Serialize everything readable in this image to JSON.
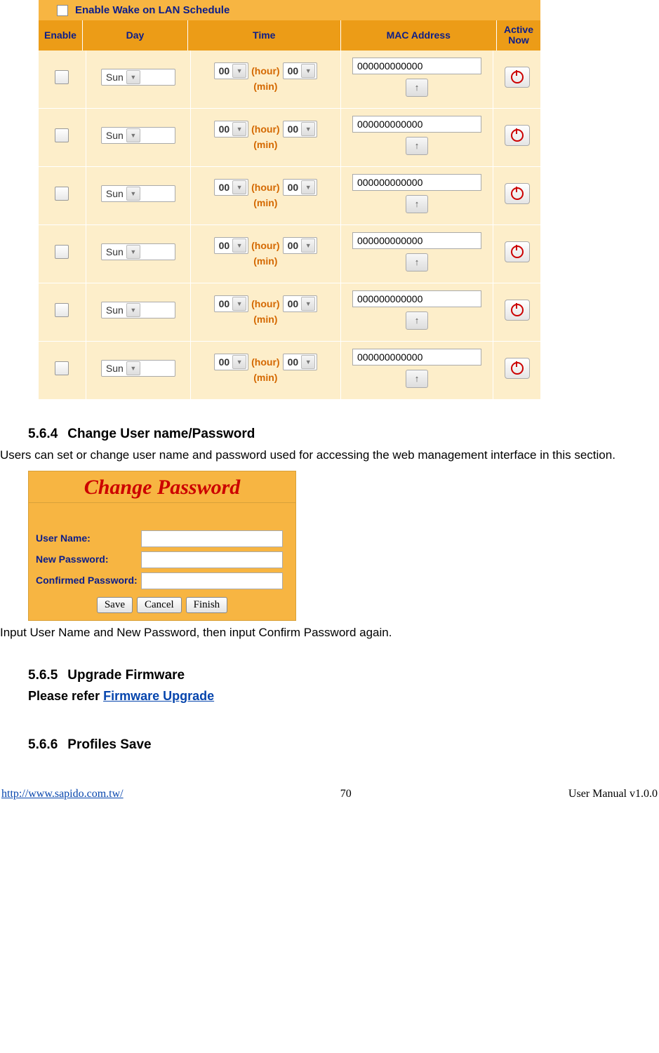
{
  "wol": {
    "title": "Enable Wake on LAN Schedule",
    "headers": {
      "enable": "Enable",
      "day": "Day",
      "time": "Time",
      "mac": "MAC Address",
      "active": "Active Now"
    },
    "hour_label": "(hour)",
    "min_label": "(min)",
    "rows": [
      {
        "day": "Sun",
        "hour": "00",
        "min": "00",
        "mac": "000000000000"
      },
      {
        "day": "Sun",
        "hour": "00",
        "min": "00",
        "mac": "000000000000"
      },
      {
        "day": "Sun",
        "hour": "00",
        "min": "00",
        "mac": "000000000000"
      },
      {
        "day": "Sun",
        "hour": "00",
        "min": "00",
        "mac": "000000000000"
      },
      {
        "day": "Sun",
        "hour": "00",
        "min": "00",
        "mac": "000000000000"
      },
      {
        "day": "Sun",
        "hour": "00",
        "min": "00",
        "mac": "000000000000"
      }
    ]
  },
  "sections": {
    "s564_num": "5.6.4",
    "s564_title": "Change User name/Password",
    "s564_body": "Users can set or change user name and password used for accessing the web management interface in this section.",
    "s564_after": "Input User Name and New Password, then input Confirm Password again.",
    "s565_num": "5.6.5",
    "s565_title": "Upgrade Firmware",
    "s565_refer_prefix": "Please refer ",
    "s565_refer_link": "Firmware Upgrade",
    "s566_num": "5.6.6",
    "s566_title": "Profiles Save"
  },
  "change_password": {
    "panel_title": "Change Password",
    "username_label": "User Name:",
    "newpw_label": "New Password:",
    "confpw_label": "Confirmed Password:",
    "btn_save": "Save",
    "btn_cancel": "Cancel",
    "btn_finish": "Finish"
  },
  "footer": {
    "url": "http://www.sapido.com.tw/",
    "page": "70",
    "right": "User Manual v1.0.0"
  }
}
